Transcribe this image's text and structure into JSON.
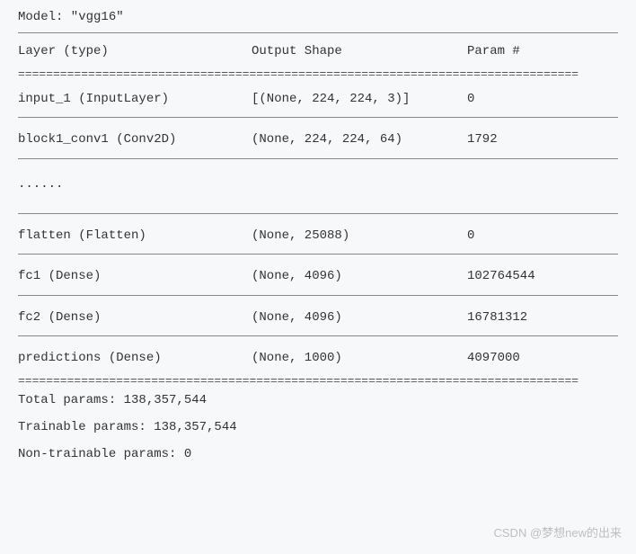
{
  "model_line": "Model: \"vgg16\"",
  "headers": {
    "layer": "Layer (type)",
    "shape": "Output Shape",
    "param": "Param #"
  },
  "rows": [
    {
      "layer": "input_1 (InputLayer)",
      "shape": "[(None, 224, 224, 3)]",
      "param": "0"
    },
    {
      "layer": "block1_conv1 (Conv2D)",
      "shape": "(None, 224, 224, 64)",
      "param": "1792"
    }
  ],
  "ellipsis": "......",
  "rows2": [
    {
      "layer": "flatten (Flatten)",
      "shape": "(None, 25088)",
      "param": "0"
    },
    {
      "layer": "fc1 (Dense)",
      "shape": "(None, 4096)",
      "param": "102764544"
    },
    {
      "layer": "fc2 (Dense)",
      "shape": "(None, 4096)",
      "param": "16781312"
    },
    {
      "layer": "predictions (Dense)",
      "shape": "(None, 1000)",
      "param": "4097000"
    }
  ],
  "summary": {
    "total": "Total params: 138,357,544",
    "trainable": "Trainable params: 138,357,544",
    "nontrainable": "Non-trainable params: 0"
  },
  "watermark": "CSDN @梦想new的出来",
  "dblbar": "================================================================================"
}
